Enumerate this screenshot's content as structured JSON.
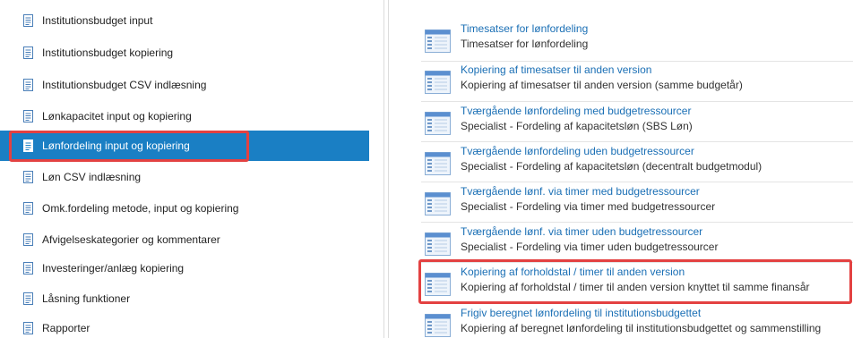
{
  "sidebar": {
    "items": [
      {
        "label": "Institutionsbudget input"
      },
      {
        "label": "Institutionsbudget kopiering"
      },
      {
        "label": "Institutionsbudget CSV indlæsning"
      },
      {
        "label": "Lønkapacitet input og kopiering"
      },
      {
        "label": "Lønfordeling input og kopiering",
        "active": true
      },
      {
        "label": "Løn CSV indlæsning"
      },
      {
        "label": "Omk.fordeling metode, input og kopiering"
      },
      {
        "label": "Afvigelseskategorier og kommentarer"
      },
      {
        "label": "Investeringer/anlæg kopiering"
      },
      {
        "label": "Låsning funktioner"
      },
      {
        "label": "Rapporter"
      }
    ]
  },
  "main": {
    "entries": [
      {
        "title": "Timesatser for lønfordeling",
        "desc": "Timesatser for lønfordeling"
      },
      {
        "title": "Kopiering af timesatser til anden version",
        "desc": "Kopiering af timesatser til anden version (samme budgetår)"
      },
      {
        "title": "Tværgående lønfordeling med budgetressourcer",
        "desc": "Specialist - Fordeling af kapacitetsløn (SBS Løn)"
      },
      {
        "title": "Tværgående lønfordeling uden budgetressourcer",
        "desc": "Specialist - Fordeling af kapacitetsløn (decentralt budgetmodul)"
      },
      {
        "title": "Tværgående lønf. via timer med budgetressourcer",
        "desc": "Specialist - Fordeling via timer med budgetressourcer"
      },
      {
        "title": "Tværgående lønf. via timer uden budgetressourcer",
        "desc": "Specialist - Fordeling via timer uden budgetressourcer"
      },
      {
        "title": "Kopiering af forholdstal / timer til anden version",
        "desc": "Kopiering af forholdstal / timer til anden version knyttet til samme finansår"
      },
      {
        "title": "Frigiv beregnet lønfordeling til institutionsbudgettet",
        "desc": "Kopiering af beregnet lønfordeling til institutionsbudgettet og sammenstilling"
      }
    ]
  },
  "colors": {
    "accent": "#1a7fc4",
    "link": "#1a6fb5",
    "highlight": "#e34141"
  },
  "icons": {
    "sidebar_item": "document-icon",
    "report_entry": "report-icon"
  }
}
